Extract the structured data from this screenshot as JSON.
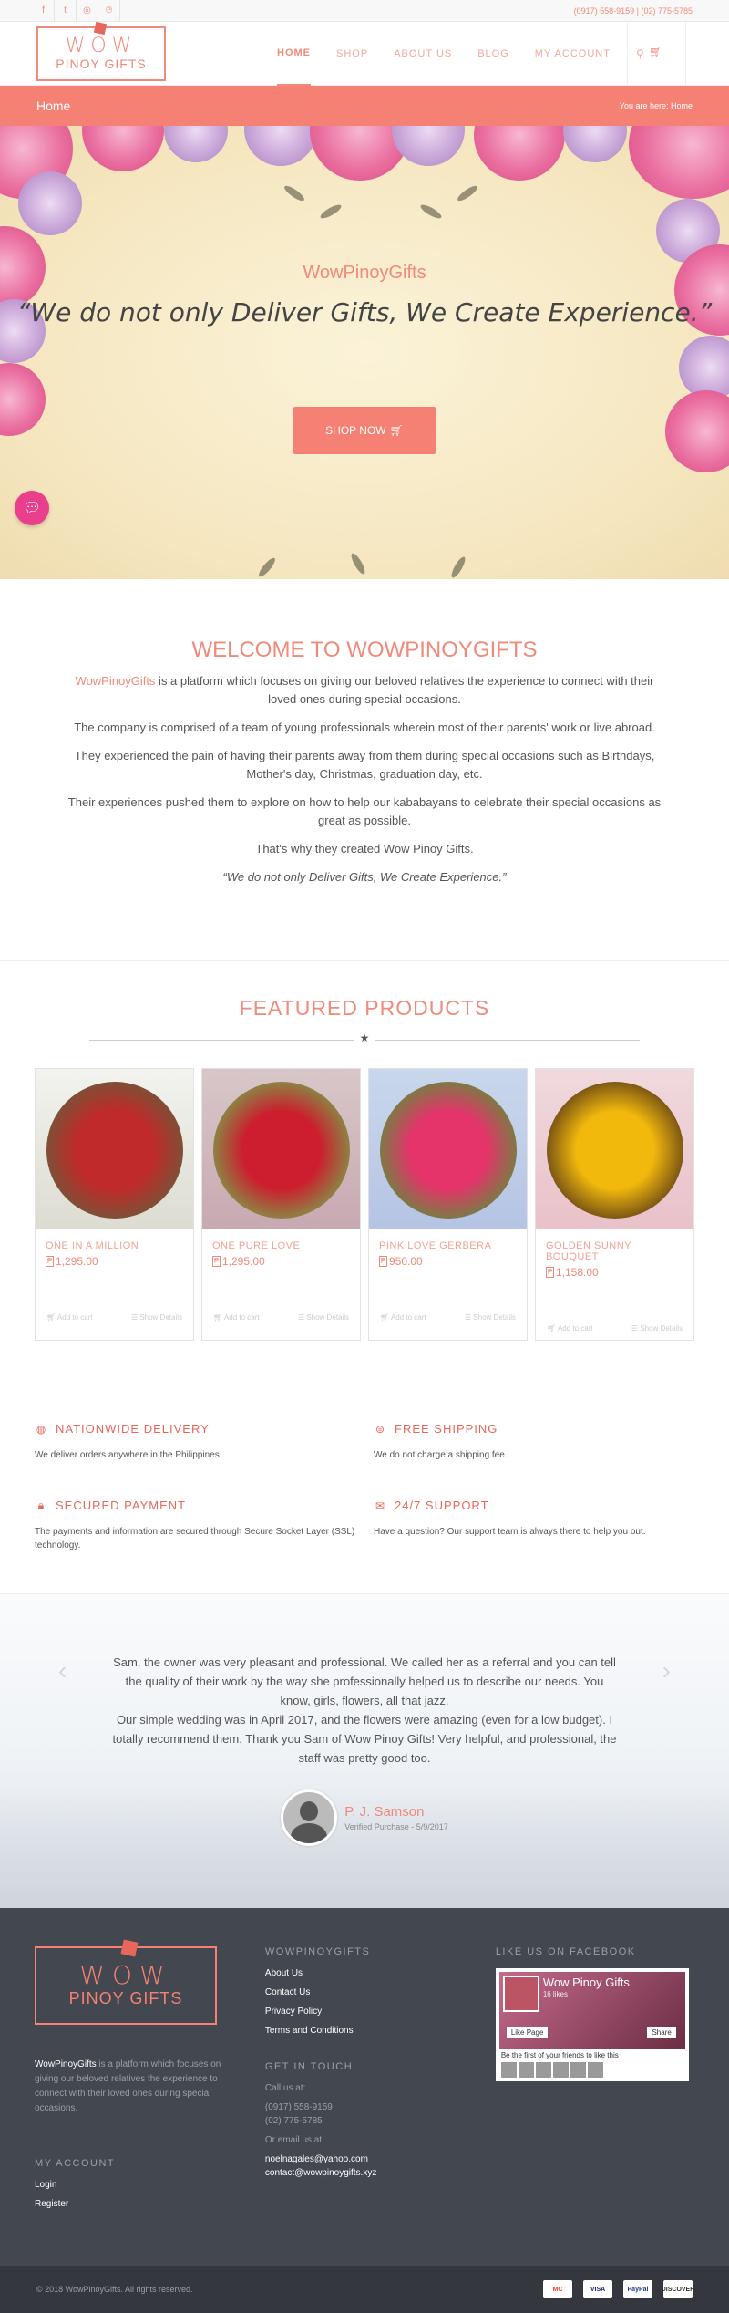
{
  "topbar": {
    "social": [
      {
        "icon": "facebook-icon",
        "glyph": "f"
      },
      {
        "icon": "twitter-icon",
        "glyph": "t"
      },
      {
        "icon": "instagram-icon",
        "glyph": "◎"
      },
      {
        "icon": "pinterest-icon",
        "glyph": "℗"
      }
    ],
    "phones": "(0917) 558-9159 | (02) 775-5785"
  },
  "header": {
    "logo_line1": "WOW",
    "logo_line2": "PINOY GIFTS",
    "nav": [
      "HOME",
      "SHOP",
      "ABOUT US",
      "BLOG",
      "MY ACCOUNT"
    ]
  },
  "titlebar": {
    "title": "Home",
    "breadcrumb": "You are here: Home"
  },
  "hero": {
    "brand": "WowPinoyGifts",
    "quote": "“We do not only Deliver Gifts, We Create Experience.”",
    "cta": "SHOP NOW"
  },
  "welcome": {
    "title": "WELCOME TO WOWPINOYGIFTS",
    "p1_brand": "WowPinoyGifts",
    "p1_rest": " is a platform which focuses on giving our beloved relatives the experience to connect with their loved ones during special occasions.",
    "p2": "The company is comprised of a team of young professionals wherein most of their parents' work or live abroad.",
    "p3": "They experienced the pain of having their parents away from them during special occasions such as Birthdays, Mother's day, Christmas, graduation day, etc.",
    "p4": "Their experiences pushed them to explore on how to help our kababayans to celebrate their special occasions as great as possible.",
    "p5": "That's why they created Wow Pinoy Gifts.",
    "p6": "“We do not only Deliver Gifts, We Create Experience.”"
  },
  "featured": {
    "title": "FEATURED PRODUCTS",
    "add_label": "Add to cart",
    "details_label": "Show Details",
    "products": [
      {
        "name": "ONE IN A MILLION",
        "price": "1,295.00",
        "colors": [
          "#f3f3ef",
          "#dcdcd2",
          "#c02a2a",
          "#6c5a3a"
        ]
      },
      {
        "name": "ONE PURE LOVE",
        "price": "1,295.00",
        "colors": [
          "#d8c7c9",
          "#c8a9b1",
          "#cc1e2e",
          "#7aa04a"
        ]
      },
      {
        "name": "PINK LOVE GERBERA",
        "price": "950.00",
        "colors": [
          "#c9d7ec",
          "#b6c4e4",
          "#e4346a",
          "#5f8e3a"
        ]
      },
      {
        "name": "GOLDEN SUNNY BOUQUET",
        "price": "1,158.00",
        "colors": [
          "#f0d9dd",
          "#e9c1c9",
          "#f2b90d",
          "#5a3a15"
        ]
      }
    ]
  },
  "features": [
    {
      "icon": "globe-icon",
      "glyph": "◍",
      "title": "NATIONWIDE DELIVERY",
      "text": "We deliver orders anywhere in the Philippines."
    },
    {
      "icon": "shipping-icon",
      "glyph": "⊜",
      "title": "FREE SHIPPING",
      "text": "We do not charge a shipping fee."
    },
    {
      "icon": "lock-icon",
      "glyph": "🔒︎",
      "title": "SECURED PAYMENT",
      "text": "The payments and information are secured through Secure Socket Layer (SSL) technology."
    },
    {
      "icon": "support-chat-icon",
      "glyph": "✉",
      "title": "24/7 SUPPORT",
      "text": "Have a question? Our support team is always there to help you out."
    }
  ],
  "testimonial": {
    "text": "Sam, the owner was very pleasant and professional. We called her as a referral and you can tell the quality of their work by the way she professionally helped us to describe our needs. You know, girls, flowers, all that jazz.\nOur simple wedding was in April 2017, and the flowers were amazing (even for a low budget). I totally recommend them. Thank you Sam of Wow Pinoy Gifts! Very helpful, and professional, the staff was pretty good too.",
    "author": "P. J. Samson",
    "meta": "Verified Purchase - 5/9/2017"
  },
  "footer": {
    "logo_line1": "WOW",
    "logo_line2": "PINOY GIFTS",
    "desc_brand": "WowPinoyGifts",
    "desc_rest": " is a platform which focuses on giving our beloved relatives the experience to connect with their loved ones during special occasions.",
    "account_head": "MY ACCOUNT",
    "account_links": [
      "Login",
      "Register"
    ],
    "col2_head": "WOWPINOYGIFTS",
    "col2_links": [
      "About Us",
      "Contact Us",
      "Privacy Policy",
      "Terms and Conditions"
    ],
    "touch_head": "GET IN TOUCH",
    "call_label": "Call us at:",
    "phone1": "(0917) 558-9159",
    "phone2": "(02) 775-5785",
    "email_label": "Or email us at:",
    "email1": "noelnagales@yahoo.com",
    "email2": "contact@wowpinoygifts.xyz",
    "fb_head": "LIKE US ON FACEBOOK",
    "fb_page": "Wow Pinoy Gifts",
    "fb_likes": "16 likes",
    "fb_like_btn": "Like Page",
    "fb_share_btn": "Share",
    "fb_first": "Be the first of your friends to like this",
    "copyright": "© 2018 WowPinoyGifts. All rights reserved.",
    "payment_cards": [
      {
        "label": "MC",
        "color": "#e8412c"
      },
      {
        "label": "VISA",
        "color": "#1a1f71"
      },
      {
        "label": "PayPal",
        "color": "#253b80"
      },
      {
        "label": "DISCOVER",
        "color": "#333333"
      }
    ]
  }
}
